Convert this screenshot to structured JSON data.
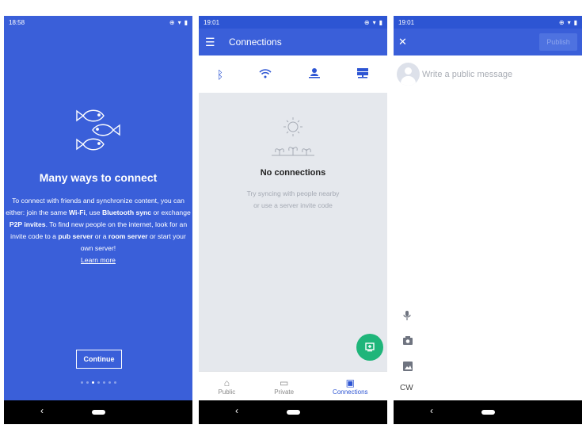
{
  "phone1": {
    "status_time": "18:58",
    "title": "Many ways to connect",
    "body": {
      "t1": "To connect with friends and synchronize content, you can either: join the same ",
      "wifi": "Wi-Fi",
      "t2": ", use ",
      "bluetooth": "Bluetooth sync",
      "t3": " or exchange ",
      "p2p": "P2P invites",
      "t4": ". To find new people on the internet, look for an invite code to a ",
      "pub": "pub server",
      "t5": " or a ",
      "room": "room server",
      "t6": " or start your own server!",
      "link": "Learn more"
    },
    "continue_label": "Continue",
    "dots_total": 7,
    "dots_active_index": 2,
    "icons": [
      "fish-icon"
    ]
  },
  "phone2": {
    "status_time": "19:01",
    "title": "Connections",
    "tabs": [
      "bluetooth-icon",
      "wifi-icon",
      "person-pin-icon",
      "server-icon"
    ],
    "empty_title": "No connections",
    "empty_hint_line1": "Try syncing with people nearby",
    "empty_hint_line2": "or use a server invite code",
    "bottom_nav": [
      {
        "label": "Public",
        "icon": "public-icon",
        "active": false
      },
      {
        "label": "Private",
        "icon": "chat-icon",
        "active": false
      },
      {
        "label": "Connections",
        "icon": "computer-icon",
        "active": true
      }
    ]
  },
  "phone3": {
    "status_time": "19:01",
    "publish_label": "Publish",
    "message_placeholder": "Write a public message",
    "cw_label": "CW",
    "tools": [
      "mic-icon",
      "camera-icon",
      "image-icon"
    ]
  },
  "colors": {
    "primary": "#3a5fd9",
    "status_dark": "#2d55d3",
    "fab_green": "#1fb57a",
    "empty_bg": "#e5e8ed"
  }
}
